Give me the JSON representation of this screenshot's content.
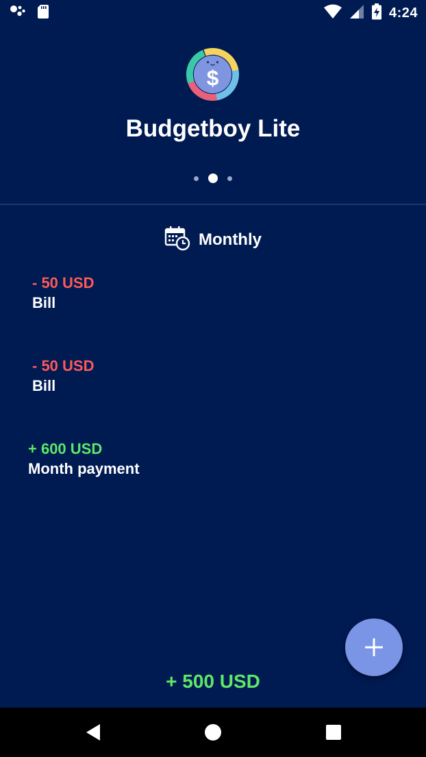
{
  "status_bar": {
    "time": "4:24",
    "icons": [
      "assistant-dots-icon",
      "sd-card-icon",
      "wifi-icon",
      "signal-icon",
      "battery-charging-icon"
    ]
  },
  "header": {
    "app_title": "Budgetboy Lite",
    "logo_icon": "dollar-coin-icon",
    "pager": {
      "pages": 3,
      "active_index": 1
    }
  },
  "period": {
    "icon": "calendar-clock-icon",
    "label": "Monthly"
  },
  "transactions": [
    {
      "amount": "- 50 USD",
      "description": "Bill",
      "type": "expense"
    },
    {
      "amount": "- 50 USD",
      "description": "Bill",
      "type": "expense"
    },
    {
      "amount": "+ 600 USD",
      "description": "Month payment",
      "type": "income"
    }
  ],
  "total": "+ 500 USD",
  "fab": {
    "icon": "plus-icon"
  },
  "nav_bar": {
    "icons": [
      "back-icon",
      "home-icon",
      "recents-icon"
    ]
  },
  "colors": {
    "background": "#001a52",
    "expense": "#ff5a5a",
    "income": "#5ee86a",
    "fab": "#7a94e6",
    "divider": "#1a3573"
  }
}
